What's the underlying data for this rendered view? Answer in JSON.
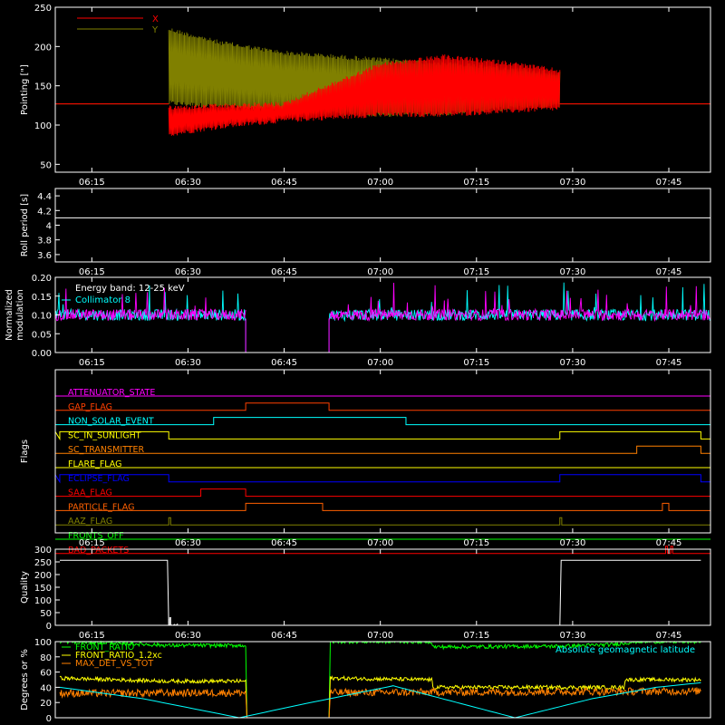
{
  "chart_data": [
    {
      "id": "pointing",
      "type": "line",
      "ylabel": "Pointing [\"]",
      "ylim": [
        40,
        250
      ],
      "yticks": [
        50,
        100,
        150,
        200,
        250
      ],
      "xticks": [
        "06:15",
        "06:30",
        "06:45",
        "07:00",
        "07:15",
        "07:30",
        "07:45"
      ],
      "legend_position": "top-left",
      "series": [
        {
          "name": "X",
          "color": "#ff0000",
          "baseline": 127,
          "active_start": "06:27",
          "active_end": "07:28",
          "envelope_low": [
            {
              "t": "06:27",
              "v": 85
            },
            {
              "t": "06:35",
              "v": 95
            },
            {
              "t": "06:45",
              "v": 103
            },
            {
              "t": "07:00",
              "v": 110
            },
            {
              "t": "07:10",
              "v": 110
            },
            {
              "t": "07:20",
              "v": 115
            },
            {
              "t": "07:28",
              "v": 118
            }
          ],
          "envelope_high": [
            {
              "t": "06:27",
              "v": 125
            },
            {
              "t": "06:45",
              "v": 130
            },
            {
              "t": "07:00",
              "v": 180
            },
            {
              "t": "07:10",
              "v": 190
            },
            {
              "t": "07:20",
              "v": 182
            },
            {
              "t": "07:28",
              "v": 172
            }
          ]
        },
        {
          "name": "Y",
          "color": "#808000",
          "baseline": 127,
          "active_start": "06:27",
          "active_end": "07:28",
          "envelope_low": [
            {
              "t": "06:27",
              "v": 125
            },
            {
              "t": "06:45",
              "v": 115
            },
            {
              "t": "07:00",
              "v": 110
            },
            {
              "t": "07:10",
              "v": 112
            },
            {
              "t": "07:20",
              "v": 118
            },
            {
              "t": "07:28",
              "v": 122
            }
          ],
          "envelope_high": [
            {
              "t": "06:27",
              "v": 225
            },
            {
              "t": "06:35",
              "v": 208
            },
            {
              "t": "06:45",
              "v": 195
            },
            {
              "t": "07:00",
              "v": 186
            },
            {
              "t": "07:10",
              "v": 182
            },
            {
              "t": "07:20",
              "v": 175
            },
            {
              "t": "07:28",
              "v": 168
            }
          ]
        }
      ]
    },
    {
      "id": "roll",
      "type": "line",
      "ylabel": "Roll period [s]",
      "ylim": [
        3.5,
        4.5
      ],
      "yticks": [
        3.6,
        3.8,
        4.0,
        4.2,
        4.4
      ],
      "xticks": [
        "06:15",
        "06:30",
        "06:45",
        "07:00",
        "07:15",
        "07:30",
        "07:45"
      ],
      "series": [
        {
          "name": "",
          "color": "#ffffff",
          "value": 4.1
        }
      ]
    },
    {
      "id": "modulation",
      "type": "line",
      "ylabel": "Normalized modulation",
      "ylim": [
        0.0,
        0.2
      ],
      "yticks": [
        "0.00",
        "0.05",
        "0.10",
        "0.15",
        "0.20"
      ],
      "xticks": [
        "06:15",
        "06:30",
        "06:45",
        "07:00",
        "07:15",
        "07:30",
        "07:45"
      ],
      "annotation": "Energy band: 12-25 keV",
      "legend_position": "top-left",
      "gap_start": "06:39",
      "gap_end": "06:52",
      "series": [
        {
          "name": "Collimator 8",
          "color": "#00ffff",
          "mean": 0.1,
          "spread": 0.015
        },
        {
          "name": "",
          "color": "#ff00ff",
          "mean": 0.1,
          "spread": 0.015
        }
      ]
    },
    {
      "id": "flags",
      "type": "line",
      "ylabel": "Flags",
      "xticks": [
        "06:15",
        "06:30",
        "06:45",
        "07:00",
        "07:15",
        "07:30",
        "07:45"
      ],
      "series": [
        {
          "name": "ATTENUATOR_STATE",
          "color": "#ff00ff",
          "steps": []
        },
        {
          "name": "GAP_FLAG",
          "color": "#ff4000",
          "steps": [
            [
              "06:39",
              "06:52"
            ]
          ]
        },
        {
          "name": "NON_SOLAR_EVENT",
          "color": "#00ffff",
          "steps": [
            [
              "06:34",
              "07:04"
            ]
          ]
        },
        {
          "name": "SC_IN_SUNLIGHT",
          "color": "#ffff00",
          "steps": [
            [
              "06:10",
              "06:27"
            ],
            [
              "07:28",
              "07:50"
            ]
          ]
        },
        {
          "name": "SC_TRANSMITTER",
          "color": "#ff8000",
          "steps": [
            [
              "07:40",
              "07:50"
            ]
          ]
        },
        {
          "name": "FLARE_FLAG",
          "color": "#ffff00",
          "steps": []
        },
        {
          "name": "ECLIPSE_FLAG",
          "color": "#0000ff",
          "steps": [
            [
              "06:10",
              "06:27"
            ],
            [
              "07:28",
              "07:50"
            ]
          ]
        },
        {
          "name": "SAA_FLAG",
          "color": "#ff0000",
          "steps": [
            [
              "06:32",
              "06:39"
            ]
          ]
        },
        {
          "name": "PARTICLE_FLAG",
          "color": "#ff6000",
          "steps": [
            [
              "06:39",
              "06:51"
            ],
            [
              "07:44",
              "07:45"
            ]
          ]
        },
        {
          "name": "AAZ_FLAG",
          "color": "#808000",
          "steps": [
            [
              "06:27",
              "06:27.3"
            ],
            [
              "07:28",
              "07:28.3"
            ]
          ]
        },
        {
          "name": "FRONTS_OFF",
          "color": "#00ff00",
          "steps": []
        },
        {
          "name": "BAD_PACKETS",
          "color": "#ff0000",
          "steps": [
            [
              "07:44.5",
              "07:44.8"
            ],
            [
              "07:45.3",
              "07:45.6"
            ]
          ]
        }
      ]
    },
    {
      "id": "quality",
      "type": "line",
      "ylabel": "Quality",
      "ylim": [
        0,
        300
      ],
      "yticks": [
        0,
        50,
        100,
        150,
        200,
        250,
        300
      ],
      "xticks": [
        "06:15",
        "06:30",
        "06:45",
        "07:00",
        "07:15",
        "07:30",
        "07:45"
      ],
      "series": [
        {
          "name": "",
          "color": "#ffffff",
          "points": [
            [
              "06:10",
              256
            ],
            [
              "06:26.8",
              256
            ],
            [
              "06:27",
              0
            ],
            [
              "07:28",
              0
            ],
            [
              "07:28.2",
              256
            ],
            [
              "07:50",
              256
            ]
          ]
        }
      ]
    },
    {
      "id": "geo",
      "type": "line",
      "ylabel": "Degrees or %",
      "ylim": [
        0,
        100
      ],
      "yticks": [
        0,
        20,
        40,
        60,
        80,
        100
      ],
      "legend_position": "top-left",
      "series": [
        {
          "name": "FRONT_RATIO",
          "color": "#00ff00",
          "points": [
            [
              "06:10",
              100
            ],
            [
              "06:17",
              99
            ],
            [
              "06:27",
              95
            ],
            [
              "06:39",
              95
            ],
            [
              "06:39.2",
              0
            ],
            [
              "06:52",
              0
            ],
            [
              "06:52.2",
              100
            ],
            [
              "07:08",
              100
            ],
            [
              "07:08.2",
              93
            ],
            [
              "07:28",
              94
            ],
            [
              "07:36",
              96
            ],
            [
              "07:40",
              100
            ],
            [
              "07:50",
              100
            ]
          ]
        },
        {
          "name": "FRONT_RATIO_1.2xc",
          "color": "#ffff00",
          "points": [
            [
              "06:10",
              52
            ],
            [
              "06:27",
              48
            ],
            [
              "06:39",
              48
            ],
            [
              "06:39.2",
              0
            ],
            [
              "06:52",
              0
            ],
            [
              "06:52.2",
              52
            ],
            [
              "07:08",
              50
            ],
            [
              "07:08.2",
              40
            ],
            [
              "07:38",
              40
            ],
            [
              "07:38.2",
              50
            ],
            [
              "07:50",
              50
            ]
          ]
        },
        {
          "name": "MAX_DET_VS_TOT",
          "color": "#ff8000",
          "points": [
            [
              "06:10",
              32
            ],
            [
              "06:39",
              33
            ],
            [
              "06:39.2",
              0
            ],
            [
              "06:52",
              0
            ],
            [
              "06:52.2",
              33
            ],
            [
              "07:50",
              35
            ]
          ]
        },
        {
          "name": "Absolute geomagnetic latitude",
          "color": "#00ffff",
          "points": [
            [
              "06:10",
              40
            ],
            [
              "06:23",
              25
            ],
            [
              "06:38",
              0
            ],
            [
              "06:48",
              18
            ],
            [
              "07:02",
              42
            ],
            [
              "07:21",
              0
            ],
            [
              "07:33",
              25
            ],
            [
              "07:43",
              40
            ],
            [
              "07:50",
              46
            ]
          ]
        }
      ]
    }
  ]
}
